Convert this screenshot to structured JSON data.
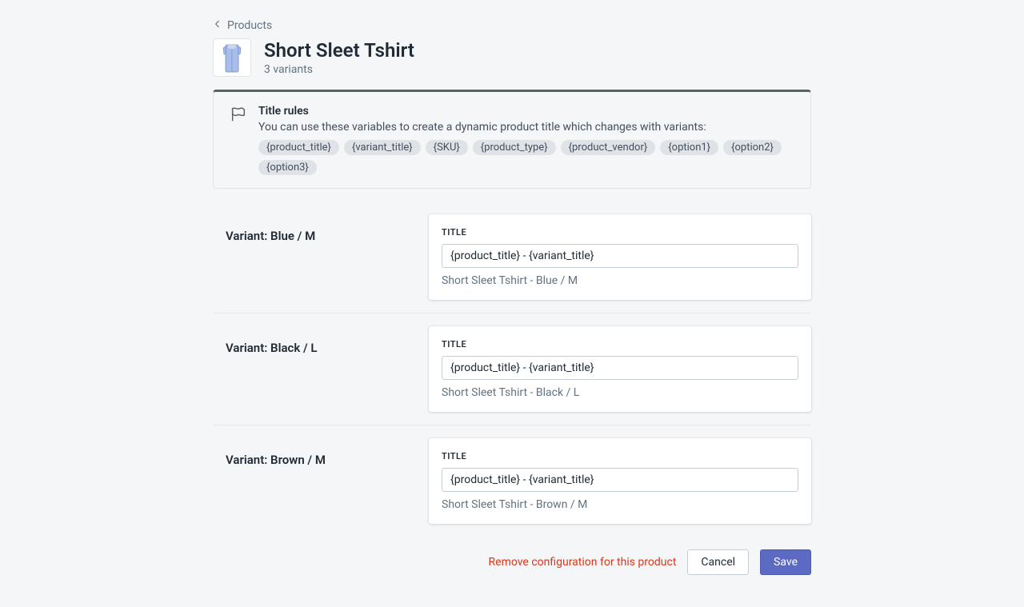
{
  "breadcrumb": {
    "label": "Products"
  },
  "header": {
    "title": "Short Sleet Tshirt",
    "subtitle": "3 variants"
  },
  "info": {
    "title": "Title rules",
    "description": "You can use these variables to create a dynamic product title which changes with variants:",
    "pills": [
      "{product_title}",
      "{variant_title}",
      "{SKU}",
      "{product_type}",
      "{product_vendor}",
      "{option1}",
      "{option2}",
      "{option3}"
    ]
  },
  "field_label": "TITLE",
  "variants": [
    {
      "label": "Variant: Blue / M",
      "value": "{product_title} - {variant_title}",
      "preview": "Short Sleet Tshirt - Blue / M"
    },
    {
      "label": "Variant: Black / L",
      "value": "{product_title} - {variant_title}",
      "preview": "Short Sleet Tshirt - Black / L"
    },
    {
      "label": "Variant: Brown / M",
      "value": "{product_title} - {variant_title}",
      "preview": "Short Sleet Tshirt - Brown / M"
    }
  ],
  "actions": {
    "remove": "Remove configuration for this product",
    "cancel": "Cancel",
    "save": "Save"
  }
}
